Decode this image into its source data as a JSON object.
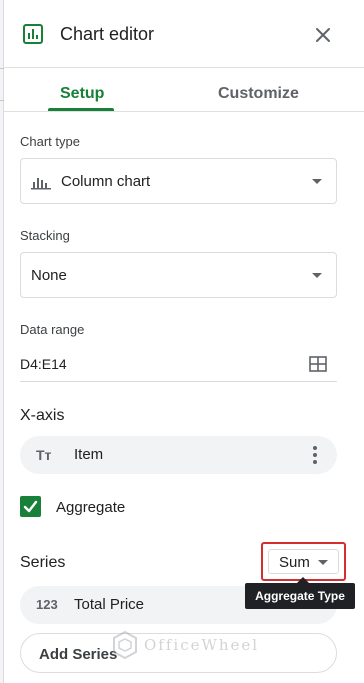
{
  "header": {
    "title": "Chart editor",
    "icon": "chart-icon",
    "close_icon": "close-icon"
  },
  "tabs": [
    {
      "label": "Setup",
      "active": true
    },
    {
      "label": "Customize",
      "active": false
    }
  ],
  "chart_type": {
    "label": "Chart type",
    "value": "Column chart",
    "icon": "column-chart-icon"
  },
  "stacking": {
    "label": "Stacking",
    "value": "None"
  },
  "data_range": {
    "label": "Data range",
    "value": "D4:E14",
    "icon": "grid-select-icon"
  },
  "x_axis": {
    "label": "X-axis",
    "item_icon_text": "Tт",
    "item_label": "Item",
    "aggregate_label": "Aggregate",
    "aggregate_checked": true
  },
  "series": {
    "label": "Series",
    "aggregate_value": "Sum",
    "item_icon_text": "123",
    "item_label": "Total Price",
    "add_label": "Add Series"
  },
  "tooltip": {
    "text": "Aggregate Type"
  },
  "watermark": {
    "text": "OfficeWheel"
  },
  "colors": {
    "accent": "#188038",
    "highlight": "#d32f2f",
    "tooltip_bg": "#202124"
  }
}
